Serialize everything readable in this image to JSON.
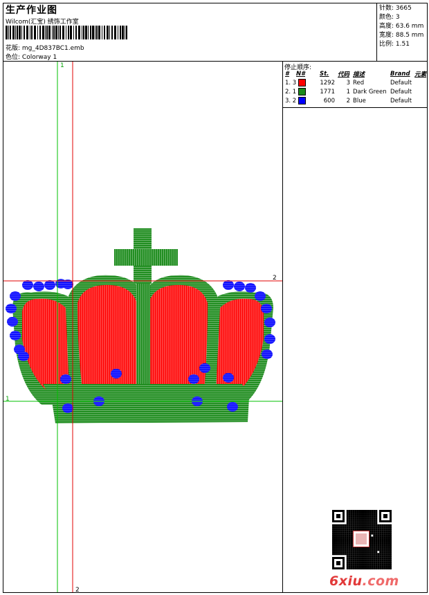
{
  "header": {
    "title": "生产作业图",
    "company": "Wilcom(汇宝) 绣饰工作室",
    "file_label": "花版: ",
    "file_name": "mg_4D837BC1.emb",
    "colorway_label": "色位: ",
    "colorway": "Colorway 1"
  },
  "stats": [
    {
      "label": "针数: ",
      "value": "3665"
    },
    {
      "label": "颜色: ",
      "value": "3"
    },
    {
      "label": "高度: ",
      "value": "63.6 mm"
    },
    {
      "label": "宽度: ",
      "value": "88.5 mm"
    },
    {
      "label": "比例: ",
      "value": "1.51"
    }
  ],
  "stop_sequence": {
    "title": "停止顺序:",
    "columns": [
      "#",
      "N#",
      "St.",
      "代码",
      "描述",
      "Brand",
      "元素"
    ],
    "rows": [
      {
        "idx": "1. 3",
        "n": "",
        "color": "#ff0000",
        "stitches": "1292",
        "code": "3",
        "desc": "Red",
        "brand": "Default"
      },
      {
        "idx": "2. 1",
        "n": "",
        "color": "#1a8a1a",
        "stitches": "1771",
        "code": "1",
        "desc": "Dark Green",
        "brand": "Default"
      },
      {
        "idx": "3. 2",
        "n": "",
        "color": "#0000ff",
        "stitches": "600",
        "code": "2",
        "desc": "Blue",
        "brand": "Default"
      }
    ]
  },
  "guides": {
    "v1_label": "1",
    "v2_label": "2",
    "h1_label": "1",
    "h2_label": "2"
  },
  "colors": {
    "red": "#ff0000",
    "green": "#1a8a1a",
    "blue": "#0000ff",
    "guide_green": "#00c000",
    "guide_red": "#e00000"
  },
  "watermark": {
    "name": "6xiu",
    "tld": ".com"
  },
  "icons": [
    "barcode-icon",
    "qr-code-icon",
    "seal-icon"
  ]
}
